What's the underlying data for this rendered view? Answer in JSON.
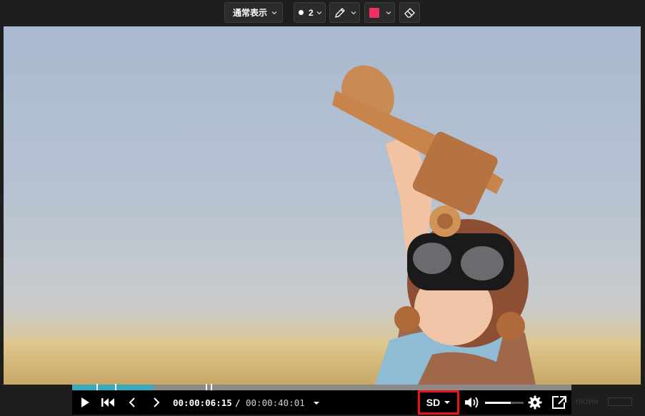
{
  "toolbar": {
    "mode_label": "通常表示",
    "brush_size": "2",
    "pen_icon": "pen-icon",
    "eraser_icon": "eraser-icon",
    "color": "#f0315f"
  },
  "player": {
    "current_time": "00:00:06:15",
    "separator": "/",
    "total_time": "00:00:40:01",
    "quality_label": "SD",
    "progress": 0.163,
    "volume": 0.67,
    "accent_color": "#3aa9be",
    "highlight_color": "#ee1111"
  },
  "watermark": {
    "text": "movie"
  }
}
